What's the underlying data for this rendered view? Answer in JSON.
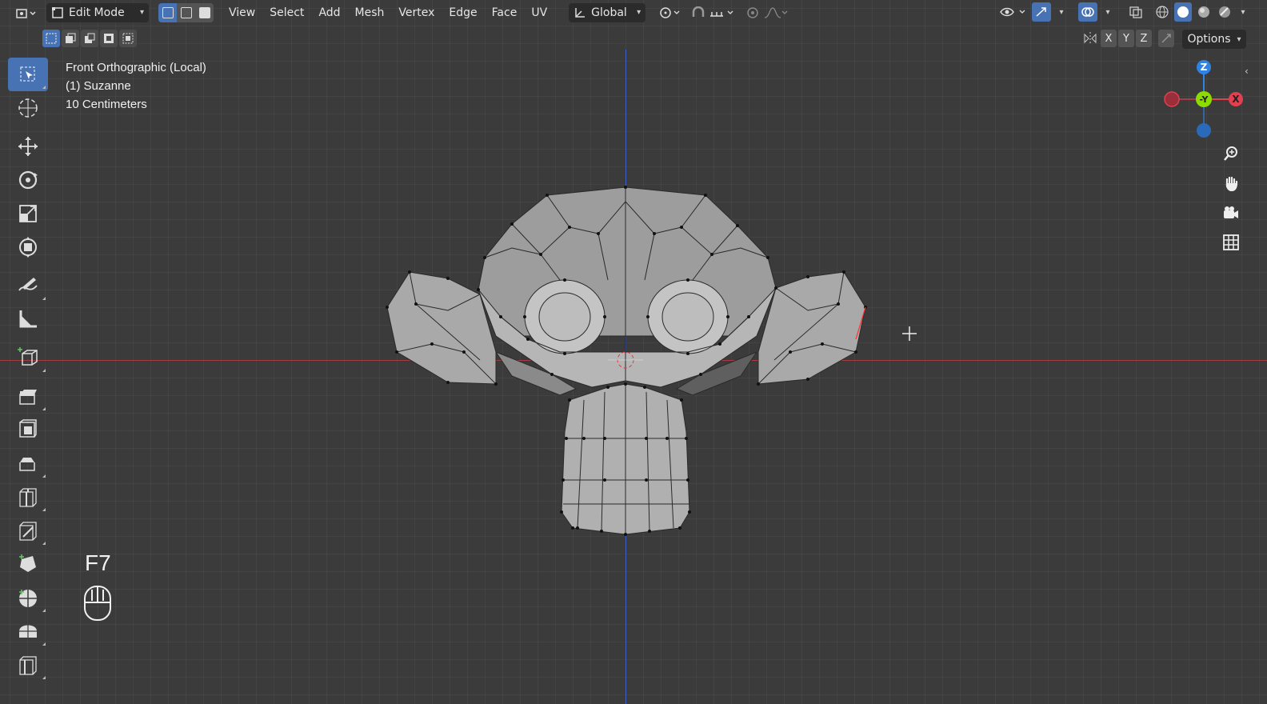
{
  "header": {
    "editor_type_icon": "editor-type-icon",
    "mode_label": "Edit Mode",
    "menus": [
      "View",
      "Select",
      "Add",
      "Mesh",
      "Vertex",
      "Edge",
      "Face",
      "UV"
    ],
    "orientation_label": "Global"
  },
  "subheader": {
    "axis_x": "X",
    "axis_y": "Y",
    "axis_z": "Z",
    "options_label": "Options"
  },
  "overlay": {
    "view_name": "Front Orthographic (Local)",
    "object_name": "(1) Suzanne",
    "scale_label": "10 Centimeters"
  },
  "gizmo": {
    "z_label": "Z",
    "y_label": "-Y",
    "x_label": "X",
    "colors": {
      "x": "#e0404f",
      "y": "#8bdc00",
      "z": "#2f84e3"
    }
  },
  "keypress": {
    "key": "F7"
  },
  "colors": {
    "accent": "#4772b3",
    "axis_x_line": "#a63a43",
    "axis_z_line": "#3b5fc4",
    "viewport_bg": "#3b3b3b"
  }
}
